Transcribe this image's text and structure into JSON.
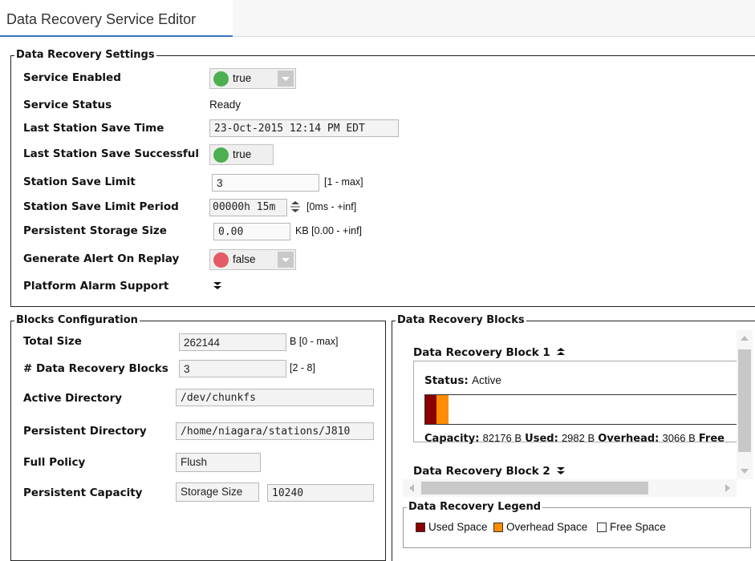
{
  "tab": {
    "title": "Data Recovery Service Editor"
  },
  "settings": {
    "legend": "Data Recovery Settings",
    "service_enabled": {
      "label": "Service Enabled",
      "value": "true",
      "status_color": "#4caf50"
    },
    "service_status": {
      "label": "Service Status",
      "value": "Ready"
    },
    "last_save_time": {
      "label": "Last Station Save Time",
      "value": "23-Oct-2015 12:14 PM EDT"
    },
    "last_save_successful": {
      "label": "Last Station Save Successful",
      "value": "true",
      "status_color": "#4caf50"
    },
    "save_limit": {
      "label": "Station Save Limit",
      "value": "3",
      "range": "[1 - max]"
    },
    "save_limit_period": {
      "label": "Station Save Limit Period",
      "value": "00000h 15m",
      "range": "[0ms - +inf]"
    },
    "storage_size": {
      "label": "Persistent Storage Size",
      "value": "0.00",
      "range": "KB [0.00 - +inf]"
    },
    "alert_on_replay": {
      "label": "Generate Alert On Replay",
      "value": "false",
      "status_color": "#e35b64"
    },
    "platform_alarm": {
      "label": "Platform Alarm Support",
      "expand_icon": "double-chevron-down-icon"
    }
  },
  "blocks_config": {
    "legend": "Blocks Configuration",
    "total_size": {
      "label": "Total Size",
      "value": "262144",
      "range": "B [0 - max]"
    },
    "num_blocks": {
      "label": "# Data Recovery Blocks",
      "value": "3",
      "range": "[2 - 8]"
    },
    "active_dir": {
      "label": "Active Directory",
      "value": "/dev/chunkfs"
    },
    "persistent_dir": {
      "label": "Persistent Directory",
      "value": "/home/niagara/stations/J810"
    },
    "full_policy": {
      "label": "Full Policy",
      "value": "Flush"
    },
    "persistent_capacity": {
      "label": "Persistent Capacity",
      "mode": "Storage Size",
      "value": "10240"
    }
  },
  "blocks": {
    "legend": "Data Recovery Blocks",
    "block1": {
      "title": "Data Recovery Block 1",
      "status_label": "Status:",
      "status_value": "Active",
      "capacity_label": "Capacity:",
      "capacity_value": "82176 B",
      "used_label": "Used:",
      "used_value": "2982 B",
      "overhead_label": "Overhead:",
      "overhead_value": "3066 B",
      "free_label": "Free",
      "used_fraction": 0.036,
      "overhead_fraction": 0.037
    },
    "block2": {
      "title": "Data Recovery Block 2"
    }
  },
  "legend_panel": {
    "legend": "Data Recovery Legend",
    "used": "Used Space",
    "overhead": "Overhead Space",
    "free": "Free Space"
  },
  "colors": {
    "used": "#8b0000",
    "overhead": "#ff8c00",
    "free": "#ffffff",
    "tab_accent": "#3b73b9"
  }
}
